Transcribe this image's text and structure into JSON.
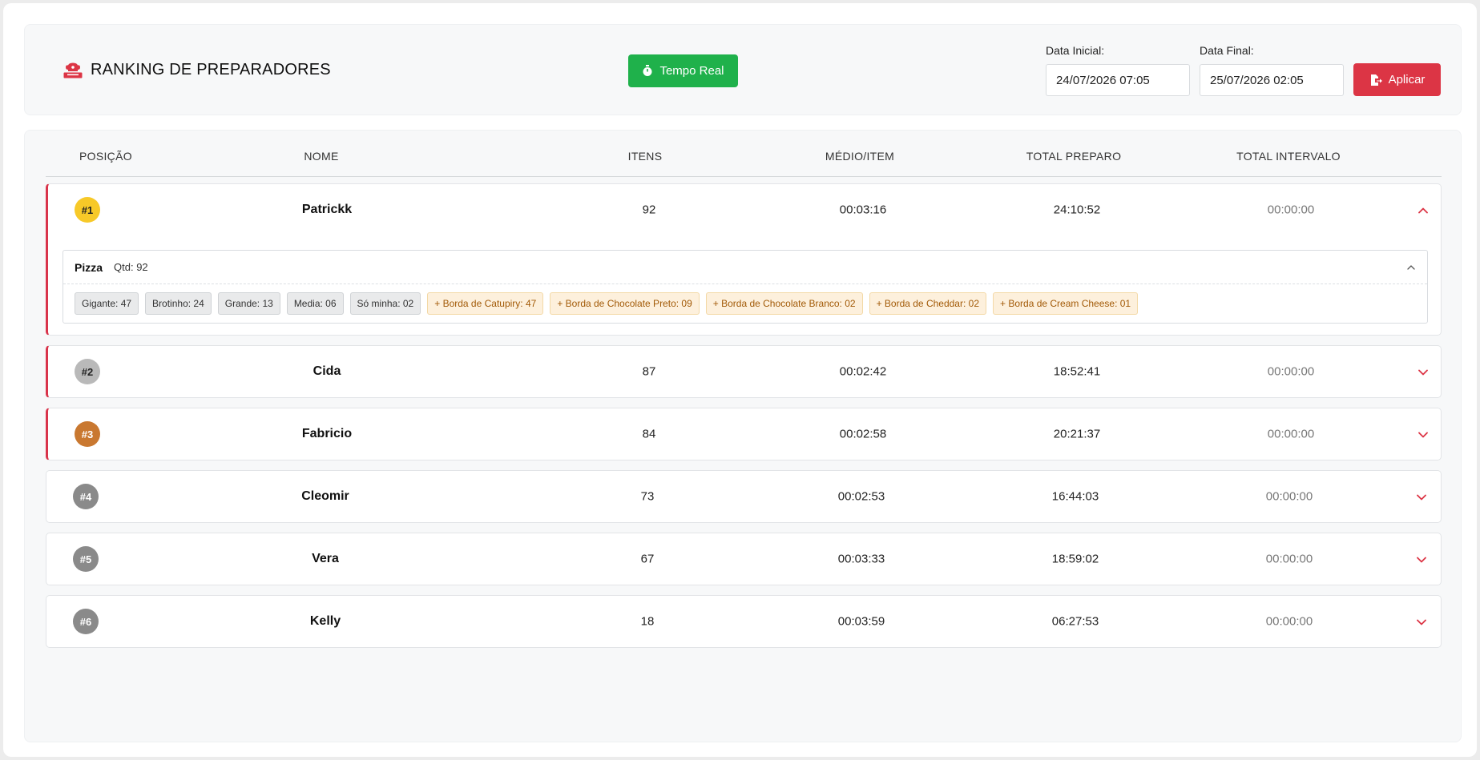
{
  "header": {
    "title": "RANKING DE PREPARADORES",
    "realtime_label": "Tempo Real",
    "start_label": "Data Inicial:",
    "start_value": "24/07/2026 07:05",
    "end_label": "Data Final:",
    "end_value": "25/07/2026 02:05",
    "apply_label": "Aplicar"
  },
  "table": {
    "columns": [
      "POSIÇÃO",
      "NOME",
      "ITENS",
      "MÉDIO/ITEM",
      "TOTAL PREPARO",
      "TOTAL INTERVALO"
    ],
    "rows": [
      {
        "rank": "#1",
        "name": "Patrickk",
        "items": "92",
        "avg": "00:03:16",
        "total": "24:10:52",
        "interval": "00:00:00",
        "badge_color": "#f7c928",
        "badge_text_color": "#222",
        "expanded": true
      },
      {
        "rank": "#2",
        "name": "Cida",
        "items": "87",
        "avg": "00:02:42",
        "total": "18:52:41",
        "interval": "00:00:00",
        "badge_color": "#b9b9b9",
        "badge_text_color": "#222",
        "expanded": false
      },
      {
        "rank": "#3",
        "name": "Fabricio",
        "items": "84",
        "avg": "00:02:58",
        "total": "20:21:37",
        "interval": "00:00:00",
        "badge_color": "#c97830",
        "badge_text_color": "#fff",
        "expanded": false
      },
      {
        "rank": "#4",
        "name": "Cleomir",
        "items": "73",
        "avg": "00:02:53",
        "total": "16:44:03",
        "interval": "00:00:00",
        "badge_color": "#8a8a8a",
        "badge_text_color": "#fff",
        "expanded": false
      },
      {
        "rank": "#5",
        "name": "Vera",
        "items": "67",
        "avg": "00:03:33",
        "total": "18:59:02",
        "interval": "00:00:00",
        "badge_color": "#8a8a8a",
        "badge_text_color": "#fff",
        "expanded": false
      },
      {
        "rank": "#6",
        "name": "Kelly",
        "items": "18",
        "avg": "00:03:59",
        "total": "06:27:53",
        "interval": "00:00:00",
        "badge_color": "#8a8a8a",
        "badge_text_color": "#fff",
        "expanded": false
      }
    ],
    "detail": {
      "category": "Pizza",
      "qty": "Qtd: 92",
      "size_chips": [
        "Gigante: 47",
        "Brotinho: 24",
        "Grande: 13",
        "Media: 06",
        "Só minha: 02"
      ],
      "border_chips": [
        "+ Borda de Catupiry: 47",
        "+ Borda de Chocolate Preto: 09",
        "+ Borda de Chocolate Branco: 02",
        "+ Borda de Cheddar: 02",
        "+ Borda de Cream Cheese: 01"
      ]
    }
  },
  "colors": {
    "accent_red": "#dc3545",
    "green": "#1fb14b",
    "top3_border": "#d9344b",
    "border_chip_bg": "#fdf0dc"
  },
  "icons": {
    "brand": "chef-hat-icon",
    "realtime": "stopwatch-icon",
    "apply": "file-export-icon",
    "row_toggle": "chevron-icon"
  }
}
